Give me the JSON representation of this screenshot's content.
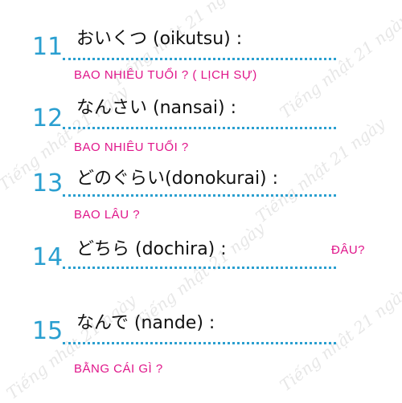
{
  "watermark_text": "Tiếng nhật 21 ngày",
  "colors": {
    "number": "#2a9fd0",
    "dots": "#2a9fd0",
    "meaning": "#e0158a",
    "term": "#111111"
  },
  "entries": [
    {
      "number": "11",
      "term": "おいくつ (oikutsu) :",
      "meaning": "BAO NHIÊU TUỔI ? ( LỊCH SỰ)"
    },
    {
      "number": "12",
      "term": "なんさい (nansai) :",
      "meaning": "BAO NHIÊU TUỔI ?"
    },
    {
      "number": "13",
      "term": "どのぐらい(donokurai) :",
      "meaning": "BAO LÂU ?"
    },
    {
      "number": "14",
      "term": "どちら (dochira) :",
      "meaning": "ĐÂU?"
    },
    {
      "number": "15",
      "term": "なんで (nande) :",
      "meaning": "BẰNG CÁI GÌ ?"
    }
  ]
}
